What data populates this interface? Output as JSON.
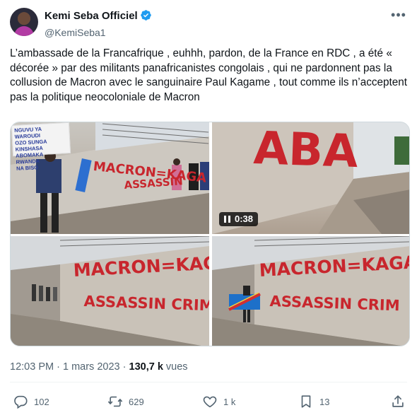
{
  "author": {
    "display_name": "Kemi Seba Officiel",
    "handle": "@KemiSeba1",
    "verified_color": "#1d9bf0"
  },
  "more_icon": "more-horizontal-icon",
  "tweet": {
    "text": "L’ambassade de la Francafrique , euhhh, pardon, de la France en RDC , a été « décorée » par des militants panafricanistes congolais , qui ne pardonnent pas la collusion de Macron avec le sanguinaire Paul Kagame , tout comme ils n’acceptent pas la politique neocoloniale de Macron"
  },
  "media": {
    "video_duration": "0:38",
    "photos": [
      {
        "graffiti": [
          "MACRON=KAGA",
          "ASSASSIN"
        ],
        "sign": [
          "NGUVU YA WAROUDI",
          "OZO SUNGA KINSHASA",
          "ABOMAKA RWANDA",
          "NA BISO"
        ]
      },
      {
        "graffiti": [
          "ABA"
        ]
      },
      {
        "graffiti": [
          "MACRON=KAGAMI",
          "ASSASSIN CRIM"
        ]
      },
      {
        "graffiti": [
          "MACRON=KAGAME",
          "ASSASSIN CRIM"
        ]
      }
    ]
  },
  "meta": {
    "time": "12:03 PM",
    "date": "1 mars 2023",
    "separator": "·",
    "views_count": "130,7 k",
    "views_label": "vues"
  },
  "actions": {
    "replies": "102",
    "reposts": "629",
    "likes": "1 k",
    "bookmarks": "13"
  }
}
